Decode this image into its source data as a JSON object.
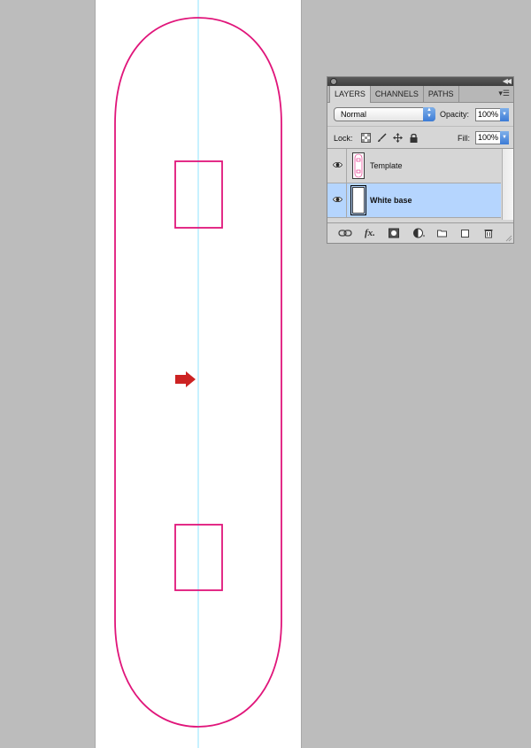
{
  "panel": {
    "tabs": [
      {
        "label": "LAYERS"
      },
      {
        "label": "CHANNELS"
      },
      {
        "label": "PATHS"
      }
    ],
    "blend_mode": "Normal",
    "opacity_label": "Opacity:",
    "opacity_value": "100%",
    "lock_label": "Lock:",
    "fill_label": "Fill:",
    "fill_value": "100%",
    "layers": [
      {
        "name": "Template",
        "visible": true,
        "selected": false
      },
      {
        "name": "White base",
        "visible": true,
        "selected": true
      }
    ],
    "bottom_icons": [
      "link-icon",
      "fx-icon",
      "mask-icon",
      "adjustment-icon",
      "folder-icon",
      "new-layer-icon",
      "trash-icon"
    ]
  },
  "colors": {
    "outline": "#e0157a",
    "guide": "#8fe3ff",
    "arrow": "#cc2222",
    "selected_row": "#b5d5fe",
    "background": "#bcbcbc"
  }
}
